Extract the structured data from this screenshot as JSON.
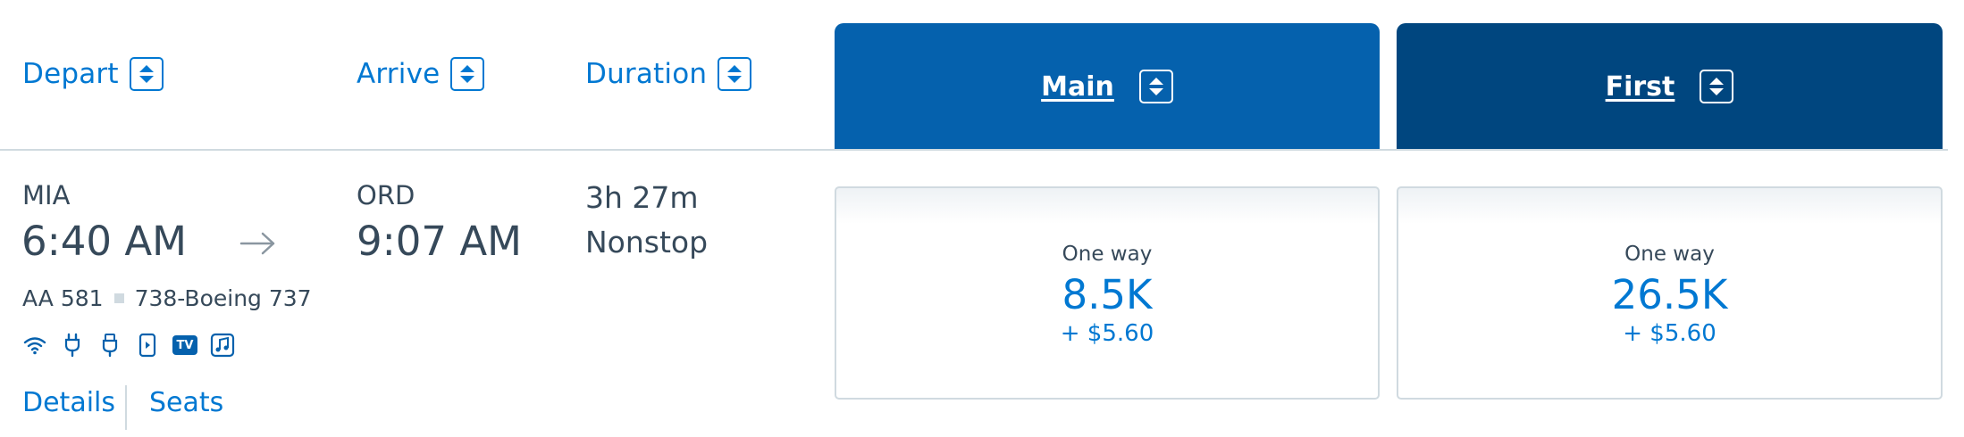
{
  "header": {
    "depart_label": "Depart",
    "arrive_label": "Arrive",
    "duration_label": "Duration"
  },
  "cabins": [
    {
      "label": "Main",
      "color": "#0561ad"
    },
    {
      "label": "First",
      "color": "#00467f"
    }
  ],
  "flight": {
    "origin": "MIA",
    "depart_time": "6:40 AM",
    "destination": "ORD",
    "arrive_time": "9:07 AM",
    "duration": "3h 27m",
    "stops": "Nonstop",
    "flight_number": "AA 581",
    "aircraft": "738-Boeing 737",
    "amenities": [
      "wifi-icon",
      "power-outlet-icon",
      "usb-icon",
      "device-entertainment-icon",
      "tv-icon",
      "music-icon"
    ],
    "tv_badge_text": "TV",
    "details_link": "Details",
    "seats_link": "Seats"
  },
  "fares": [
    {
      "label": "One way",
      "miles": "8.5K",
      "tax": "+ $5.60"
    },
    {
      "label": "One way",
      "miles": "26.5K",
      "tax": "+ $5.60"
    }
  ],
  "colors": {
    "accent": "#0078d2",
    "text": "#36495a",
    "divider": "#d0dae0"
  }
}
